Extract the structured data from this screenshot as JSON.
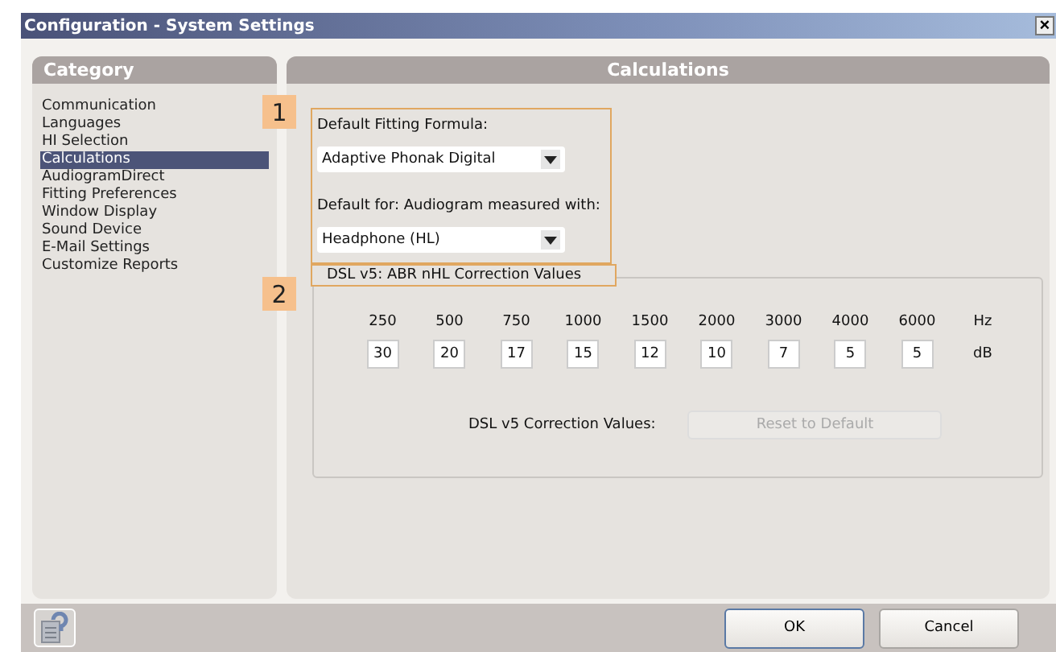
{
  "window": {
    "title": "Configuration - System Settings",
    "close": "×"
  },
  "sidebar": {
    "title": "Category",
    "items": [
      {
        "label": "Communication",
        "selected": false
      },
      {
        "label": "Languages",
        "selected": false
      },
      {
        "label": "HI Selection",
        "selected": false
      },
      {
        "label": "Calculations",
        "selected": true
      },
      {
        "label": "AudiogramDirect",
        "selected": false
      },
      {
        "label": "Fitting Preferences",
        "selected": false
      },
      {
        "label": "Window Display",
        "selected": false
      },
      {
        "label": "Sound Device",
        "selected": false
      },
      {
        "label": "E-Mail Settings",
        "selected": false
      },
      {
        "label": "Customize Reports",
        "selected": false
      }
    ]
  },
  "panel": {
    "title": "Calculations",
    "callouts": [
      "1",
      "2"
    ],
    "formula": {
      "label": "Default Fitting Formula:",
      "value": "Adaptive Phonak Digital"
    },
    "audiogram": {
      "label": "Default for: Audiogram measured with:",
      "value": "Headphone (HL)"
    },
    "group": {
      "title": "DSL v5: ABR nHL Correction Values",
      "unit_freq": "Hz",
      "unit_level": "dB",
      "columns": [
        {
          "freq": "250",
          "value": "30"
        },
        {
          "freq": "500",
          "value": "20"
        },
        {
          "freq": "750",
          "value": "17"
        },
        {
          "freq": "1000",
          "value": "15"
        },
        {
          "freq": "1500",
          "value": "12"
        },
        {
          "freq": "2000",
          "value": "10"
        },
        {
          "freq": "3000",
          "value": "7"
        },
        {
          "freq": "4000",
          "value": "5"
        },
        {
          "freq": "6000",
          "value": "5"
        }
      ],
      "reset_label": "DSL v5 Correction Values:",
      "reset_button": {
        "label": "Reset to Default",
        "disabled": true
      }
    }
  },
  "buttons": [
    "OK",
    "Cancel"
  ]
}
